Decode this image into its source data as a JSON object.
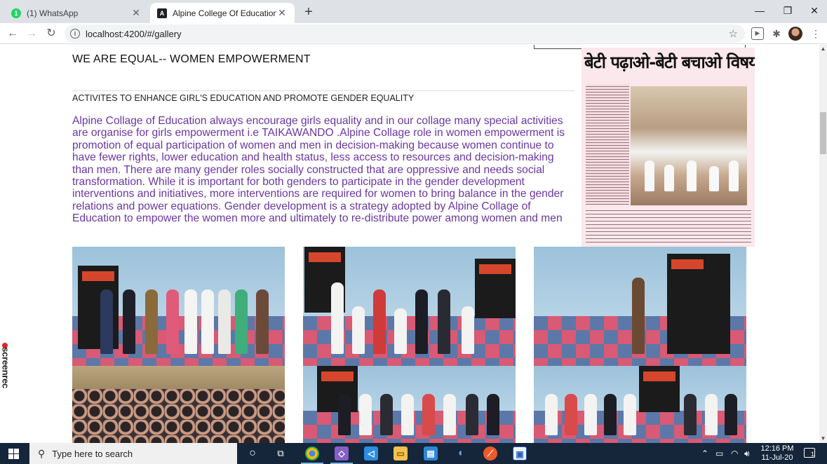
{
  "browser": {
    "tabs": [
      {
        "title": "(1) WhatsApp",
        "favicon": "whatsapp-icon",
        "favicon_glyph": "1",
        "active": false
      },
      {
        "title": "Alpine College Of Education",
        "favicon": "angular-icon",
        "favicon_glyph": "A",
        "active": true
      }
    ],
    "url": "localhost:4200/#/gallery"
  },
  "page": {
    "heading": "WE ARE EQUAL-- WOMEN EMPOWERMENT",
    "subheading": "ACTIVITES TO ENHANCE GIRL'S EDUCATION AND PROMOTE GENDER EQUALITY",
    "paragraph": "Alpine Collage of Education always encourage girls equality and in our collage many special activities are organise for girls empowerment i.e TAIKAWANDO .Alpine Collage role in women empowerment is promotion of equal participation of women and men in decision-making because women continue to have fewer rights, lower education and health status, less access to resources and decision-making than men. There are many gender roles socially constructed that are oppressive and needs social transformation. While it is important for both genders to participate in the gender development interventions and initiatives, more interventions are required for women to bring balance in the gender relations and power equations. Gender development is a strategy adopted by Alpine Collage of Education to empower the women more and ultimately to re-distribute power among women and men",
    "newspaper_headline": "बेटी पढ़ाओ-बेटी बचाओ विषय पर मंथन",
    "accent_color": "#6a36a5"
  },
  "watermark": {
    "text": "screenrec"
  },
  "taskbar": {
    "search_placeholder": "Type here to search",
    "time": "12:16 PM",
    "date": "11-Jul-20",
    "notification_count": "1"
  }
}
